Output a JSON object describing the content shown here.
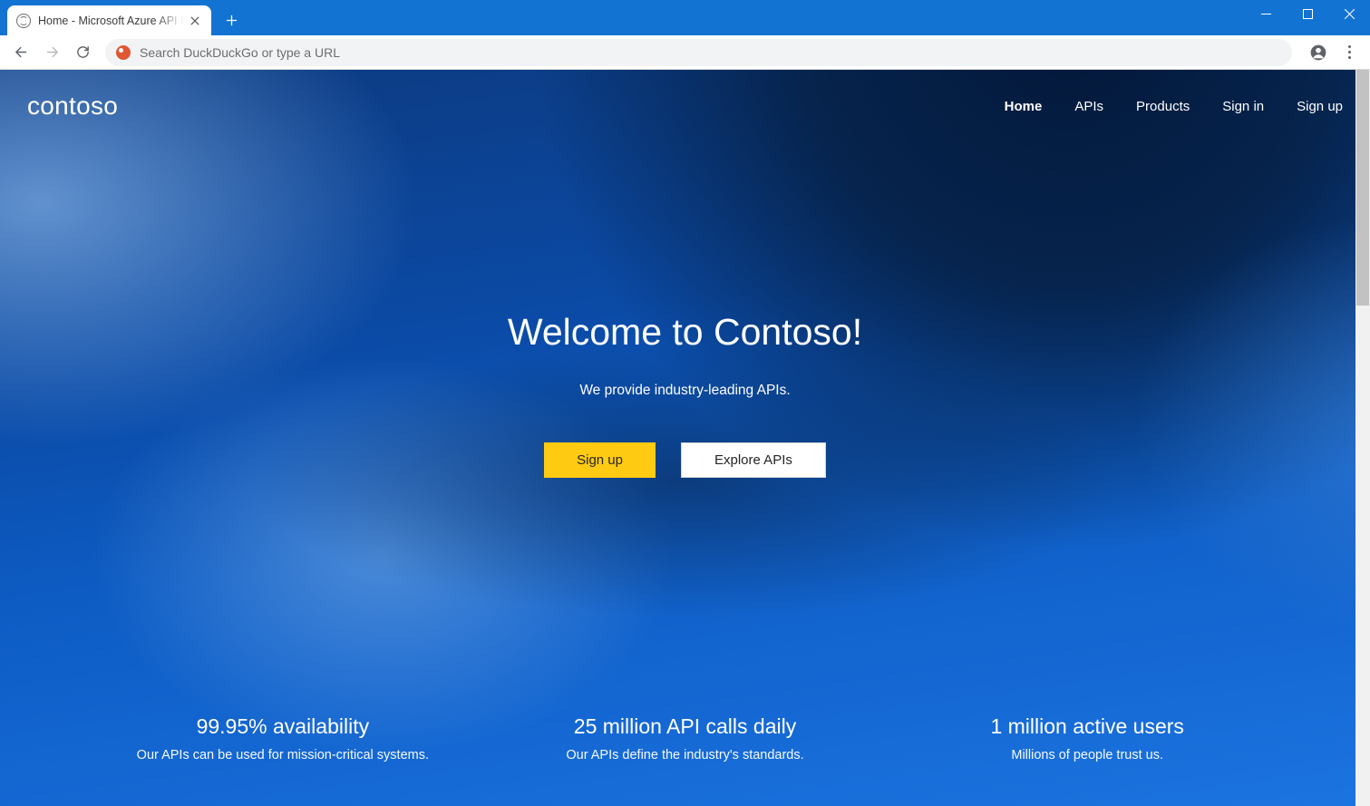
{
  "browser": {
    "tab": {
      "title": "Home - Microsoft Azure API Management"
    },
    "address_placeholder": "Search DuckDuckGo or type a URL"
  },
  "header": {
    "brand": "contoso",
    "nav": [
      {
        "label": "Home",
        "active": true
      },
      {
        "label": "APIs",
        "active": false
      },
      {
        "label": "Products",
        "active": false
      },
      {
        "label": "Sign in",
        "active": false
      },
      {
        "label": "Sign up",
        "active": false
      }
    ]
  },
  "hero": {
    "title": "Welcome to Contoso!",
    "subtitle": "We provide industry-leading APIs.",
    "primary_button": "Sign up",
    "secondary_button": "Explore APIs"
  },
  "stats": [
    {
      "title": "99.95% availability",
      "subtitle": "Our APIs can be used for mission-critical systems."
    },
    {
      "title": "25 million API calls daily",
      "subtitle": "Our APIs define the industry's standards."
    },
    {
      "title": "1 million active users",
      "subtitle": "Millions of people trust us."
    }
  ]
}
